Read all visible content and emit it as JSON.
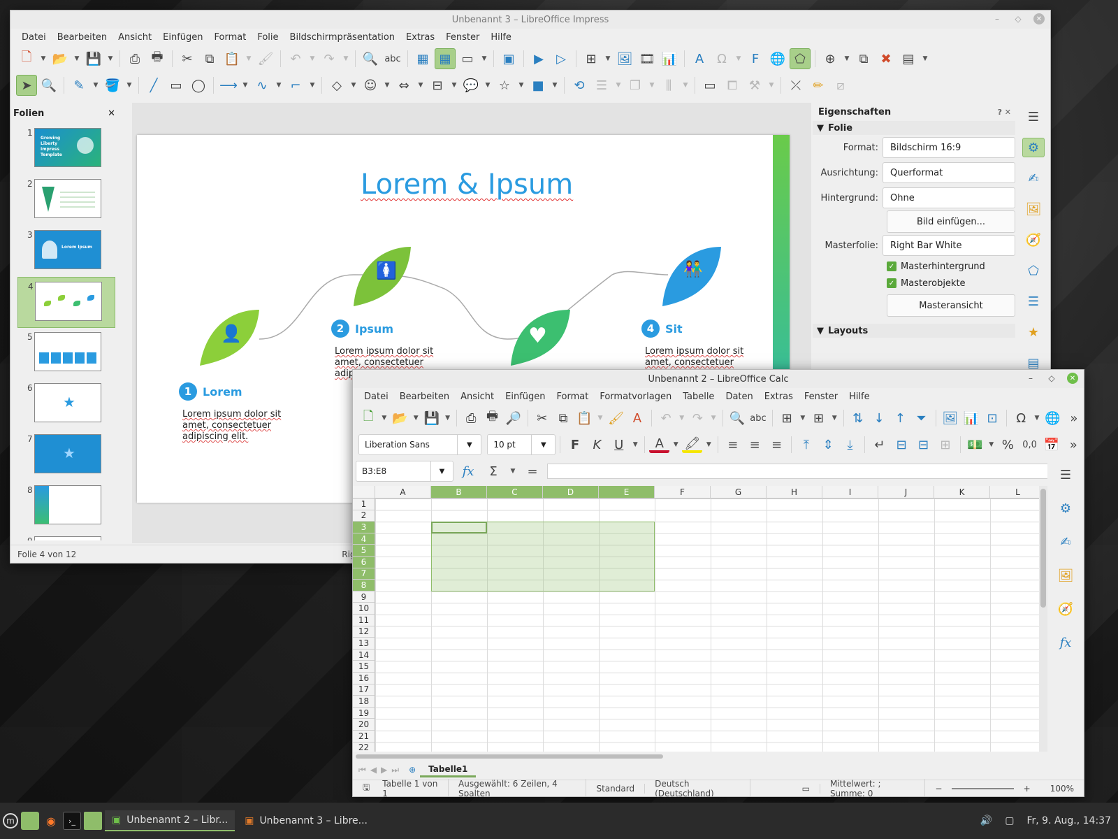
{
  "impress": {
    "title": "Unbenannt 3 – LibreOffice Impress",
    "menu": [
      "Datei",
      "Bearbeiten",
      "Ansicht",
      "Einfügen",
      "Format",
      "Folie",
      "Bildschirmpräsentation",
      "Extras",
      "Fenster",
      "Hilfe"
    ],
    "slides_pane_title": "Folien",
    "slide_numbers": [
      "1",
      "2",
      "3",
      "4",
      "5",
      "6",
      "7",
      "8",
      "9"
    ],
    "thumb1_text": "Growing Liberty Impress Template",
    "thumb3_text": "Lorem Ipsum",
    "slide": {
      "title": "Lorem & Ipsum",
      "steps": [
        {
          "num": "1",
          "label": "Lorem",
          "text": "Lorem ipsum dolor sit amet, consectetuer adipiscing elit."
        },
        {
          "num": "2",
          "label": "Ipsum",
          "text": "Lorem ipsum dolor sit amet, consectetuer adip..."
        },
        {
          "num": "4",
          "label": "Sit",
          "text": "Lorem ipsum dolor sit amet, consectetuer"
        }
      ]
    },
    "properties": {
      "title": "Eigenschaften",
      "section_folie": "Folie",
      "format_label": "Format:",
      "format_value": "Bildschirm 16:9",
      "ausrichtung_label": "Ausrichtung:",
      "ausrichtung_value": "Querformat",
      "hintergrund_label": "Hintergrund:",
      "hintergrund_value": "Ohne",
      "bild_einfuegen": "Bild einfügen...",
      "masterfolie_label": "Masterfolie:",
      "masterfolie_value": "Right Bar White",
      "masterhintergrund": "Masterhintergrund",
      "masterobjekte": "Masterobjekte",
      "masteransicht": "Masteransicht",
      "section_layouts": "Layouts"
    },
    "status": {
      "slide": "Folie 4 von 12",
      "master": "Right"
    }
  },
  "calc": {
    "title": "Unbenannt 2 – LibreOffice Calc",
    "menu": [
      "Datei",
      "Bearbeiten",
      "Ansicht",
      "Einfügen",
      "Format",
      "Formatvorlagen",
      "Tabelle",
      "Daten",
      "Extras",
      "Fenster",
      "Hilfe"
    ],
    "font_name": "Liberation Sans",
    "font_size": "10 pt",
    "bold": "F",
    "italic": "K",
    "underline": "U",
    "name_box": "B3:E8",
    "columns": [
      "A",
      "B",
      "C",
      "D",
      "E",
      "F",
      "G",
      "H",
      "I",
      "J",
      "K",
      "L"
    ],
    "rows": [
      "1",
      "2",
      "3",
      "4",
      "5",
      "6",
      "7",
      "8",
      "9",
      "10",
      "11",
      "12",
      "13",
      "14",
      "15",
      "16",
      "17",
      "18",
      "19",
      "20",
      "21",
      "22"
    ],
    "sheet_tab": "Tabelle1",
    "status": {
      "sheet": "Tabelle 1 von 1",
      "selection": "Ausgewählt: 6 Zeilen, 4 Spalten",
      "style": "Standard",
      "language": "Deutsch (Deutschland)",
      "sum": "Mittelwert: ; Summe: 0",
      "zoom": "100%"
    }
  },
  "taskbar": {
    "task1": "Unbenannt 2 – Libr...",
    "task2": "Unbenannt 3 – Libre...",
    "clock": "Fr, 9. Aug., 14:37"
  },
  "colors": {
    "accent_green": "#8fbd6a",
    "slide_blue": "#2a9be0",
    "leaf_green": "#8ccf3a"
  }
}
